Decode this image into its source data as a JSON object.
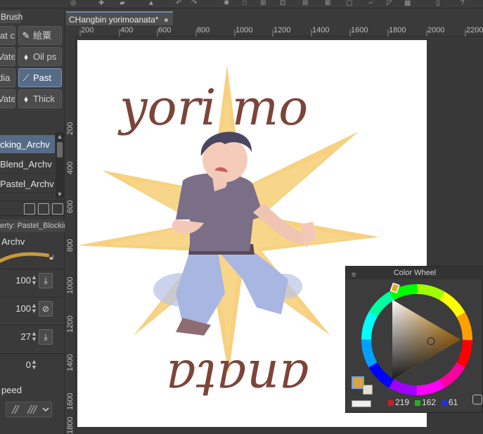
{
  "left_panel": {
    "brush_tab": "Brush",
    "tools_left": [
      "lat c",
      "Vate",
      "dia",
      "Vate"
    ],
    "tools_right": [
      "絵粟",
      "Oil ps",
      "Past",
      "Thick"
    ],
    "sub_tools": [
      "cking_Archv",
      "Blend_Archv",
      "Pastel_Archv"
    ],
    "property_title": "erty: Pastel_Blockin",
    "brush_name": "Archv",
    "values": [
      "100",
      "100",
      "27",
      "0"
    ],
    "speed_label": "peed"
  },
  "document": {
    "tab_title": "CHangbin yorimoanata*",
    "tab_dot": "●"
  },
  "ruler": {
    "h_ticks": [
      "200",
      "400",
      "600",
      "800",
      "1000",
      "1200",
      "1400",
      "1600",
      "1800",
      "2000",
      "2200"
    ],
    "v_ticks": [
      "200",
      "400",
      "600",
      "800",
      "1000",
      "1200",
      "1400",
      "1600",
      "1800"
    ]
  },
  "artwork": {
    "text_top": "yori mo",
    "text_bottom": "anata"
  },
  "color_wheel": {
    "title": "Color Wheel",
    "r": "219",
    "g": "162",
    "b": "61",
    "current_color": "#dba23d"
  }
}
